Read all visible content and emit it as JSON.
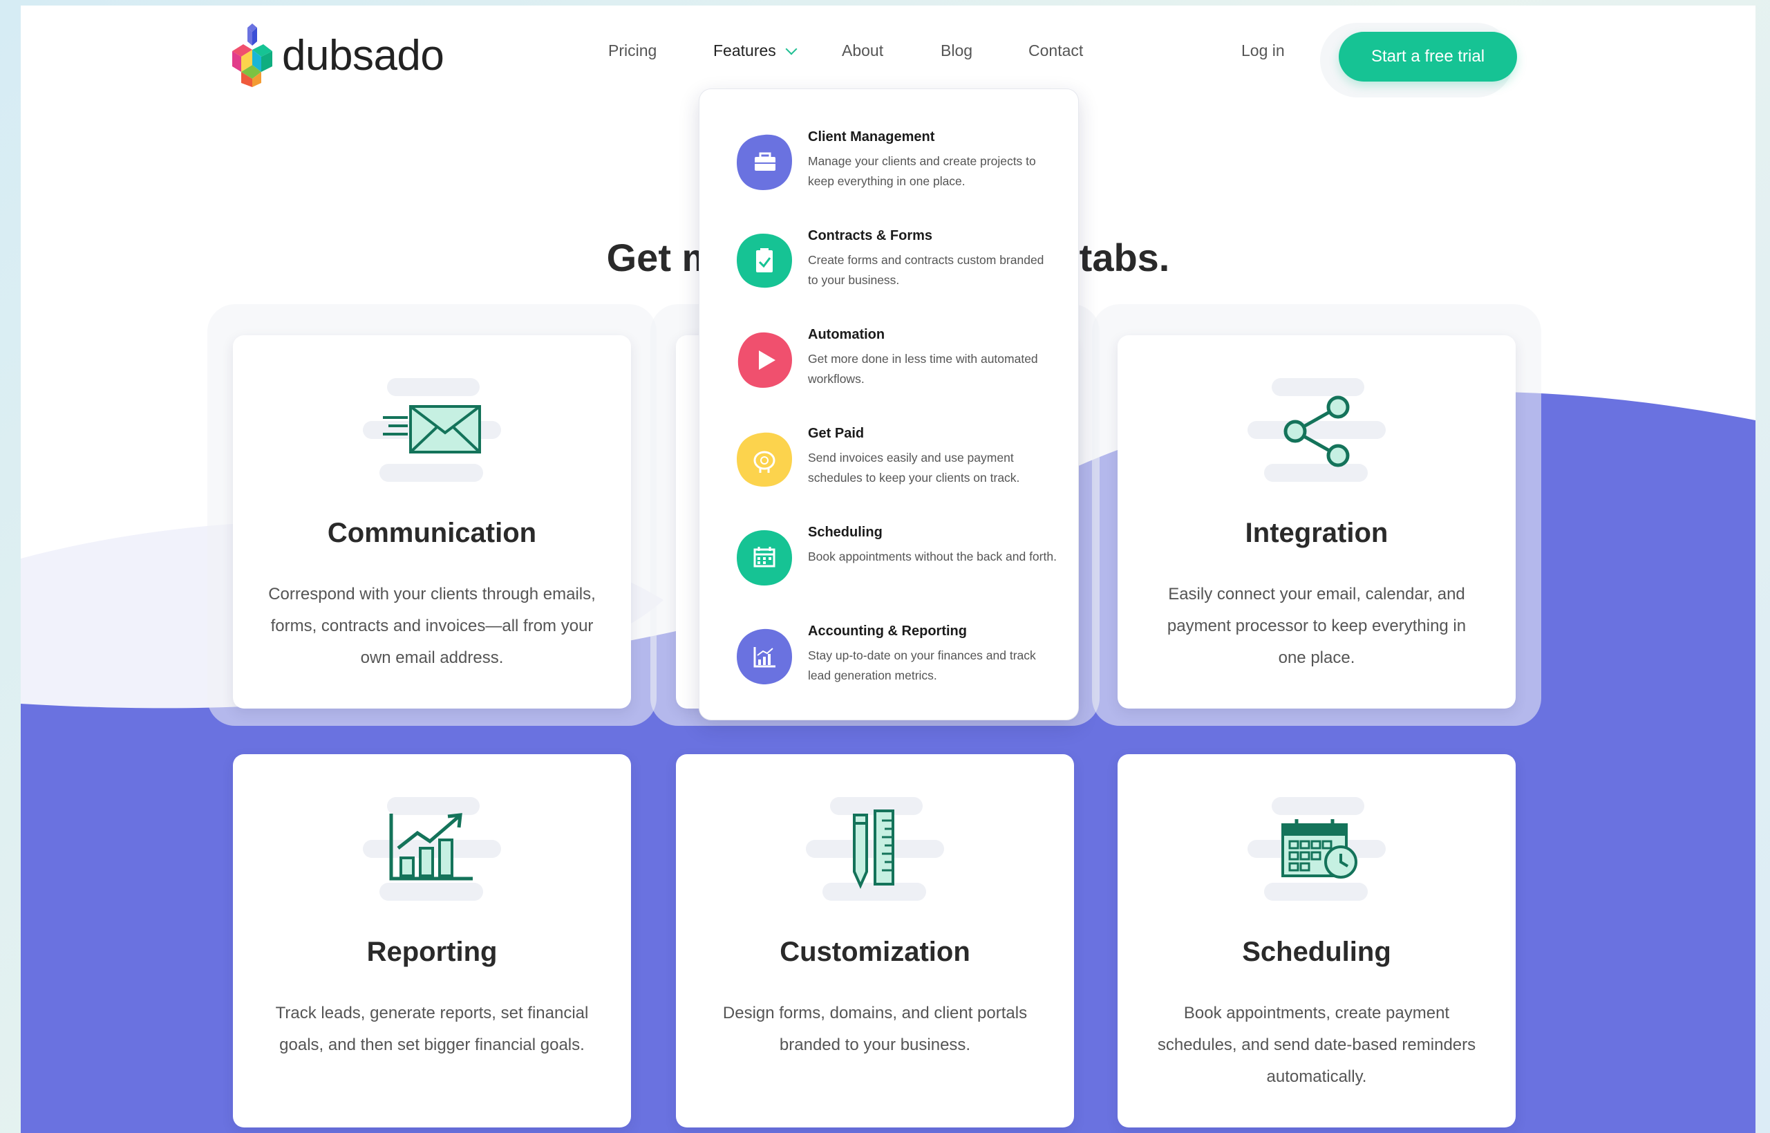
{
  "brand": {
    "name": "dubsado"
  },
  "nav": {
    "items": [
      "Pricing",
      "Features",
      "About",
      "Blog",
      "Contact"
    ],
    "login": "Log in",
    "cta": "Start a free trial"
  },
  "headline": {
    "left": "Get m",
    "right": "r tabs."
  },
  "colors": {
    "accent": "#16c394",
    "purple": "#6a72e0",
    "red": "#f0506e",
    "yellow": "#fcd34d"
  },
  "features_menu": [
    {
      "title": "Client Management",
      "desc": "Manage your clients and create projects to keep everything in one place.",
      "icon": "briefcase-icon",
      "color": "#6a72e0"
    },
    {
      "title": "Contracts & Forms",
      "desc": "Create forms and contracts custom branded to your business.",
      "icon": "clipboard-check-icon",
      "color": "#16c394"
    },
    {
      "title": "Automation",
      "desc": "Get more done in less time with automated workflows.",
      "icon": "play-icon",
      "color": "#f0506e"
    },
    {
      "title": "Get Paid",
      "desc": "Send invoices easily and use payment schedules to keep your clients on track.",
      "icon": "piggy-bank-icon",
      "color": "#fcd34d"
    },
    {
      "title": "Scheduling",
      "desc": "Book appointments without the back and forth.",
      "icon": "calendar-icon",
      "color": "#16c394"
    },
    {
      "title": "Accounting & Reporting",
      "desc": "Stay up-to-date on your finances and track lead generation metrics.",
      "icon": "bar-chart-icon",
      "color": "#6a72e0"
    }
  ],
  "cards": [
    {
      "title": "Communication",
      "text": "Correspond with your clients through emails, forms, contracts and invoices—all from your own email address.",
      "icon": "envelope-icon"
    },
    {
      "title": "Integration",
      "text": "Easily connect your email, calendar, and payment processor to keep everything in one place.",
      "icon": "share-icon"
    },
    {
      "title": "Reporting",
      "text": "Track leads, generate reports, set financial goals, and then set bigger financial goals.",
      "icon": "growth-chart-icon"
    },
    {
      "title": "Customization",
      "text": "Design forms, domains, and client portals branded to your business.",
      "icon": "pencil-ruler-icon"
    },
    {
      "title": "Scheduling",
      "text": "Book appointments, create payment schedules, and send date-based reminders automatically.",
      "icon": "calendar-clock-icon"
    }
  ]
}
